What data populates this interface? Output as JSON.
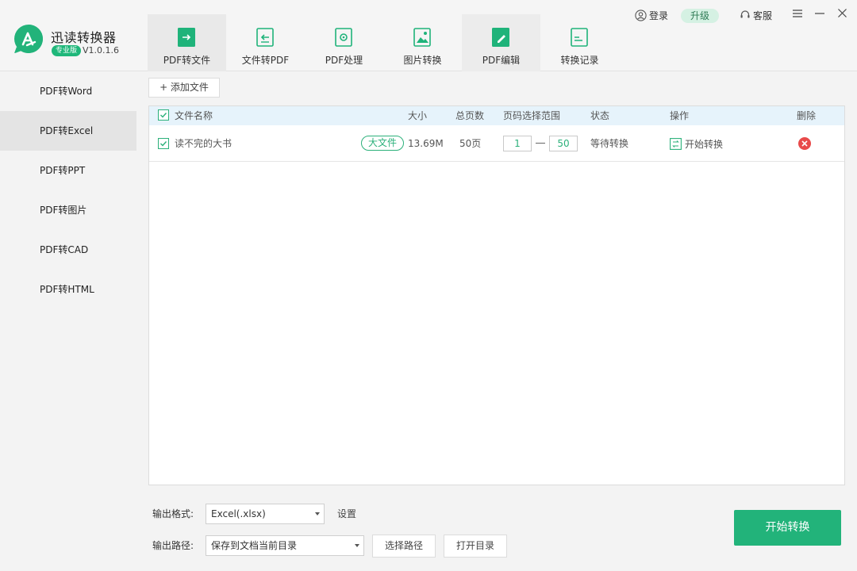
{
  "app": {
    "title": "迅读转换器",
    "edition": "专业版",
    "version": "V1.0.1.6"
  },
  "topbar": {
    "login": "登录",
    "upgrade": "升级",
    "service": "客服",
    "menu_icon": "hamburger-icon",
    "minimize_icon": "minimize-icon",
    "close_icon": "close-icon"
  },
  "tabs": [
    {
      "label": "PDF转文件",
      "icon": "pdf-export-icon"
    },
    {
      "label": "文件转PDF",
      "icon": "file-import-icon"
    },
    {
      "label": "PDF处理",
      "icon": "pdf-process-icon"
    },
    {
      "label": "图片转换",
      "icon": "image-convert-icon"
    },
    {
      "label": "PDF编辑",
      "icon": "pdf-edit-icon"
    },
    {
      "label": "转换记录",
      "icon": "history-icon"
    }
  ],
  "sidebar": {
    "items": [
      {
        "label": "PDF转Word"
      },
      {
        "label": "PDF转Excel"
      },
      {
        "label": "PDF转PPT"
      },
      {
        "label": "PDF转图片"
      },
      {
        "label": "PDF转CAD"
      },
      {
        "label": "PDF转HTML"
      }
    ],
    "active_index": 1
  },
  "main": {
    "add_file": "+ 添加文件",
    "columns": {
      "name": "文件名称",
      "size": "大小",
      "pages": "总页数",
      "range": "页码选择范围",
      "status": "状态",
      "action": "操作",
      "delete": "删除"
    },
    "rows": [
      {
        "name": "读不完的大书",
        "tag": "大文件",
        "size": "13.69M",
        "pages": "50页",
        "range_from": "1",
        "range_to": "50",
        "status": "等待转换",
        "action": "开始转换"
      }
    ]
  },
  "bottom": {
    "format_label": "输出格式:",
    "format_value": "Excel(.xlsx)",
    "settings": "设置",
    "path_label": "输出路径:",
    "path_value": "保存到文档当前目录",
    "choose_path": "选择路径",
    "open_dir": "打开目录",
    "start": "开始转换"
  },
  "colors": {
    "accent": "#22b37a",
    "header_bg": "#e6f3fb",
    "delete": "#e84a4a"
  }
}
